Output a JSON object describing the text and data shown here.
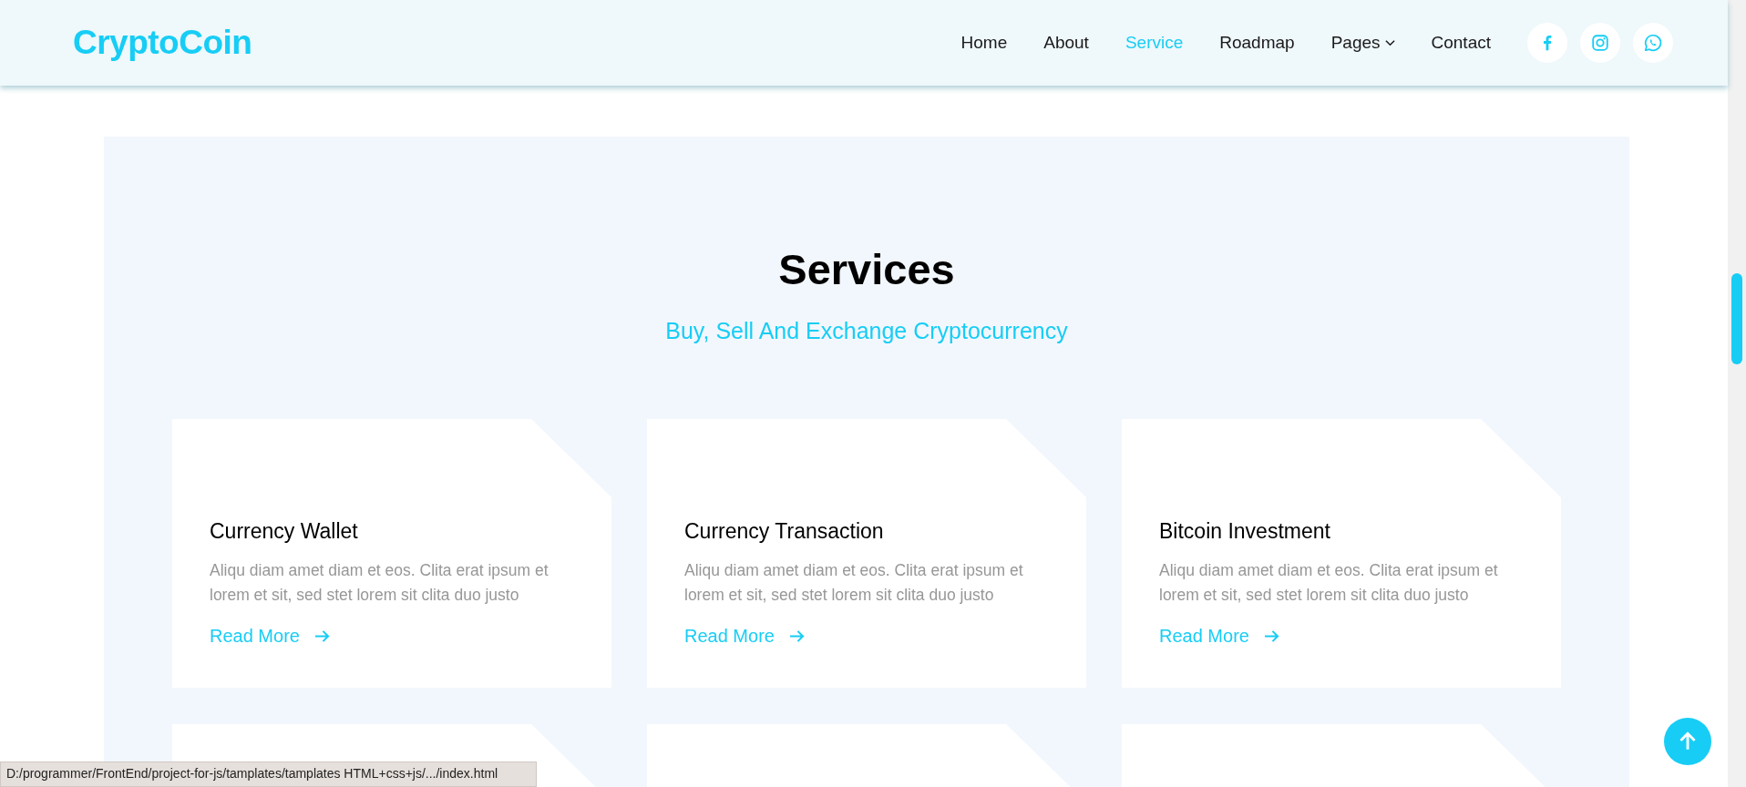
{
  "brand": "CryptoCoin",
  "nav": [
    {
      "label": "Home",
      "selected": false,
      "dropdown": false
    },
    {
      "label": "About",
      "selected": false,
      "dropdown": false
    },
    {
      "label": "Service",
      "selected": true,
      "dropdown": false
    },
    {
      "label": "Roadmap",
      "selected": false,
      "dropdown": false
    },
    {
      "label": "Pages",
      "selected": false,
      "dropdown": true
    },
    {
      "label": "Contact",
      "selected": false,
      "dropdown": false
    }
  ],
  "social": [
    {
      "kind": "facebook"
    },
    {
      "kind": "instagram"
    },
    {
      "kind": "whatsapp"
    }
  ],
  "section": {
    "title": "Services",
    "subtitle": "Buy, Sell And Exchange Cryptocurrency"
  },
  "cards": [
    {
      "title": "Currency Wallet",
      "text": "Aliqu diam amet diam et eos. Clita erat ipsum et lorem et sit, sed stet lorem sit clita duo justo",
      "link": "Read More"
    },
    {
      "title": "Currency Transaction",
      "text": "Aliqu diam amet diam et eos. Clita erat ipsum et lorem et sit, sed stet lorem sit clita duo justo",
      "link": "Read More"
    },
    {
      "title": "Bitcoin Investment",
      "text": "Aliqu diam amet diam et eos. Clita erat ipsum et lorem et sit, sed stet lorem sit clita duo justo",
      "link": "Read More"
    }
  ],
  "status_bar": "D:/programmer/FrontEnd/project-for-js/tamplates/tamplates HTML+css+js/.../index.html"
}
